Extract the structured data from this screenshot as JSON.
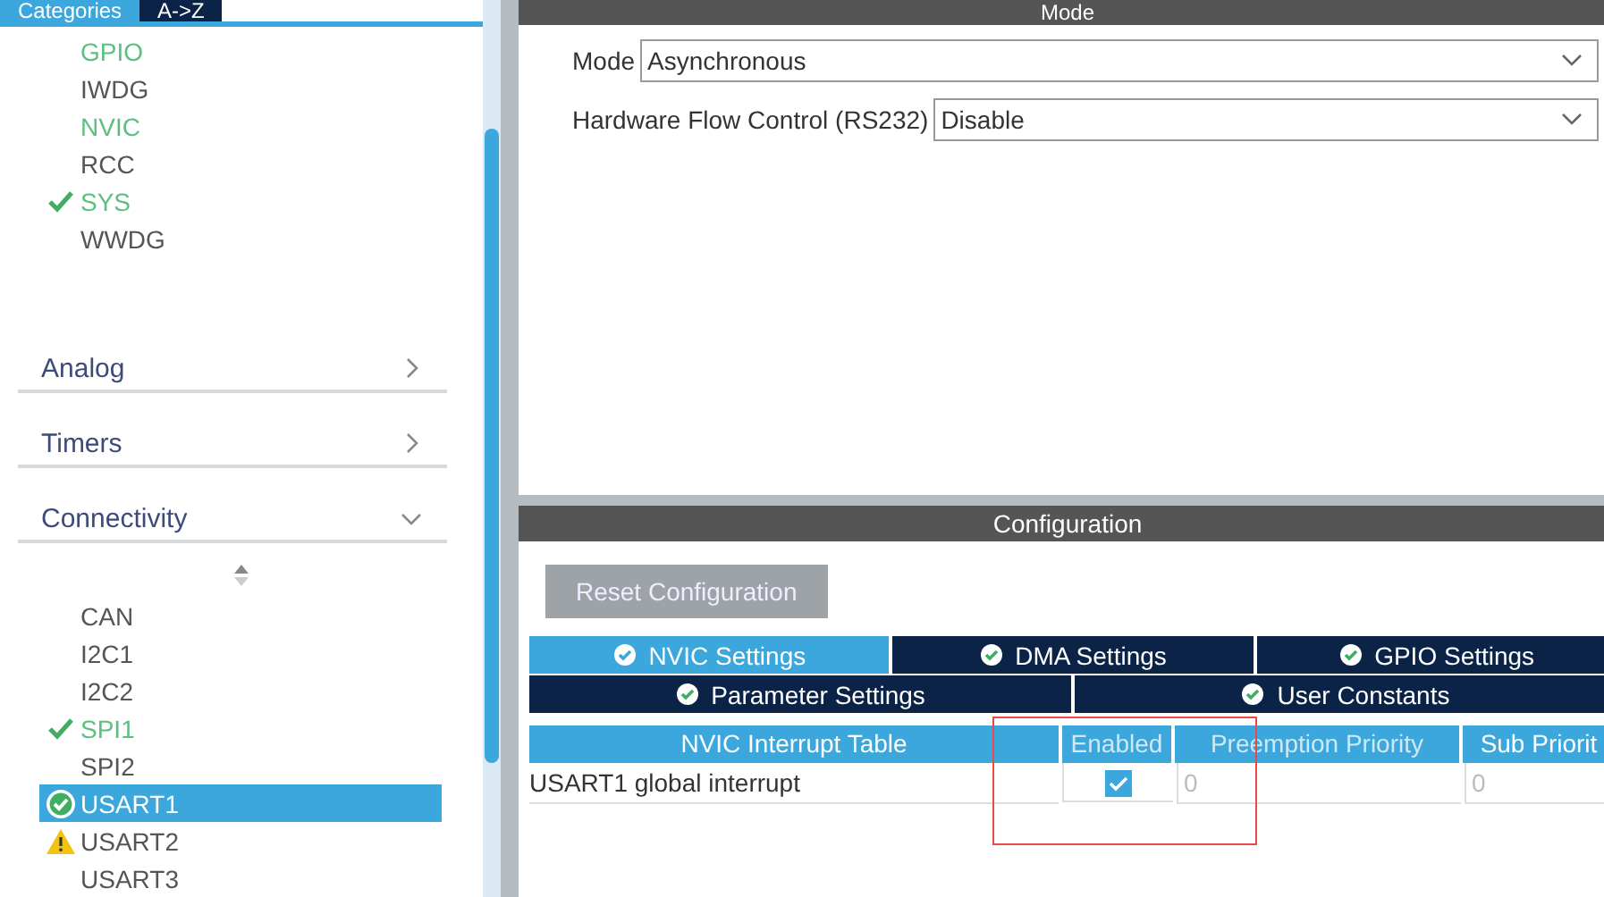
{
  "tabs": [
    {
      "label": "Categories",
      "selected": true
    },
    {
      "label": "A->Z",
      "selected": false
    }
  ],
  "system_items": [
    {
      "label": "GPIO",
      "enabled": true,
      "checked": false,
      "warning": false,
      "selected": false
    },
    {
      "label": "IWDG",
      "enabled": false,
      "checked": false,
      "warning": false,
      "selected": false
    },
    {
      "label": "NVIC",
      "enabled": true,
      "checked": false,
      "warning": false,
      "selected": false
    },
    {
      "label": "RCC",
      "enabled": false,
      "checked": false,
      "warning": false,
      "selected": false
    },
    {
      "label": "SYS",
      "enabled": true,
      "checked": true,
      "warning": false,
      "selected": false
    },
    {
      "label": "WWDG",
      "enabled": false,
      "checked": false,
      "warning": false,
      "selected": false
    }
  ],
  "sections": [
    {
      "label": "Analog",
      "expanded": false
    },
    {
      "label": "Timers",
      "expanded": false
    },
    {
      "label": "Connectivity",
      "expanded": true
    }
  ],
  "connectivity_items": [
    {
      "label": "CAN",
      "enabled": false,
      "checked": false,
      "warning": false,
      "selected": false
    },
    {
      "label": "I2C1",
      "enabled": false,
      "checked": false,
      "warning": false,
      "selected": false
    },
    {
      "label": "I2C2",
      "enabled": false,
      "checked": false,
      "warning": false,
      "selected": false
    },
    {
      "label": "SPI1",
      "enabled": true,
      "checked": true,
      "warning": false,
      "selected": false
    },
    {
      "label": "SPI2",
      "enabled": false,
      "checked": false,
      "warning": false,
      "selected": false
    },
    {
      "label": "USART1",
      "enabled": true,
      "checked": true,
      "warning": false,
      "selected": true
    },
    {
      "label": "USART2",
      "enabled": false,
      "checked": false,
      "warning": true,
      "selected": false
    },
    {
      "label": "USART3",
      "enabled": false,
      "checked": false,
      "warning": false,
      "selected": false
    }
  ],
  "mode_panel": {
    "title": "Mode",
    "fields": [
      {
        "label": "Mode",
        "value": "Asynchronous"
      },
      {
        "label": "Hardware Flow Control (RS232)",
        "value": "Disable"
      }
    ]
  },
  "configuration": {
    "title": "Configuration",
    "reset_button": "Reset Configuration",
    "tab_rows": [
      {
        "tabs": [
          {
            "label": "NVIC Settings",
            "selected": true
          },
          {
            "label": "DMA Settings",
            "selected": false
          },
          {
            "label": "GPIO Settings",
            "selected": false
          }
        ]
      },
      {
        "tabs": [
          {
            "label": "Parameter Settings",
            "selected": false
          },
          {
            "label": "User Constants",
            "selected": false
          }
        ]
      }
    ],
    "table": {
      "columns": [
        "NVIC Interrupt Table",
        "Enabled",
        "Preemption Priority",
        "Sub Priorit"
      ],
      "rows": [
        {
          "name": "USART1 global interrupt",
          "enabled": true,
          "preemption_priority": "0",
          "sub_priority": "0"
        }
      ]
    },
    "highlight_box": true
  }
}
